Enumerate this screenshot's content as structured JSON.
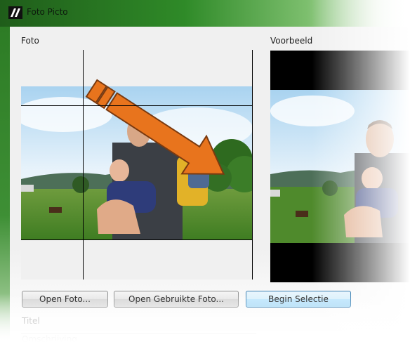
{
  "window": {
    "title": "Foto Picto"
  },
  "photo": {
    "label": "Foto"
  },
  "preview": {
    "label": "Voorbeeld"
  },
  "buttons": {
    "open_photo": "Open Foto...",
    "open_used_photo": "Open Gebruikte Foto...",
    "begin_selection": "Begin Selectie"
  },
  "fields": {
    "title_label": "Titel",
    "description_label": "Omschrijving"
  },
  "colors": {
    "titlebar_green": "#2f8a28",
    "arrow_orange": "#e8741d",
    "active_button_border": "#3c7fb1"
  },
  "icons": {
    "app_icon": "picto-app-icon"
  }
}
